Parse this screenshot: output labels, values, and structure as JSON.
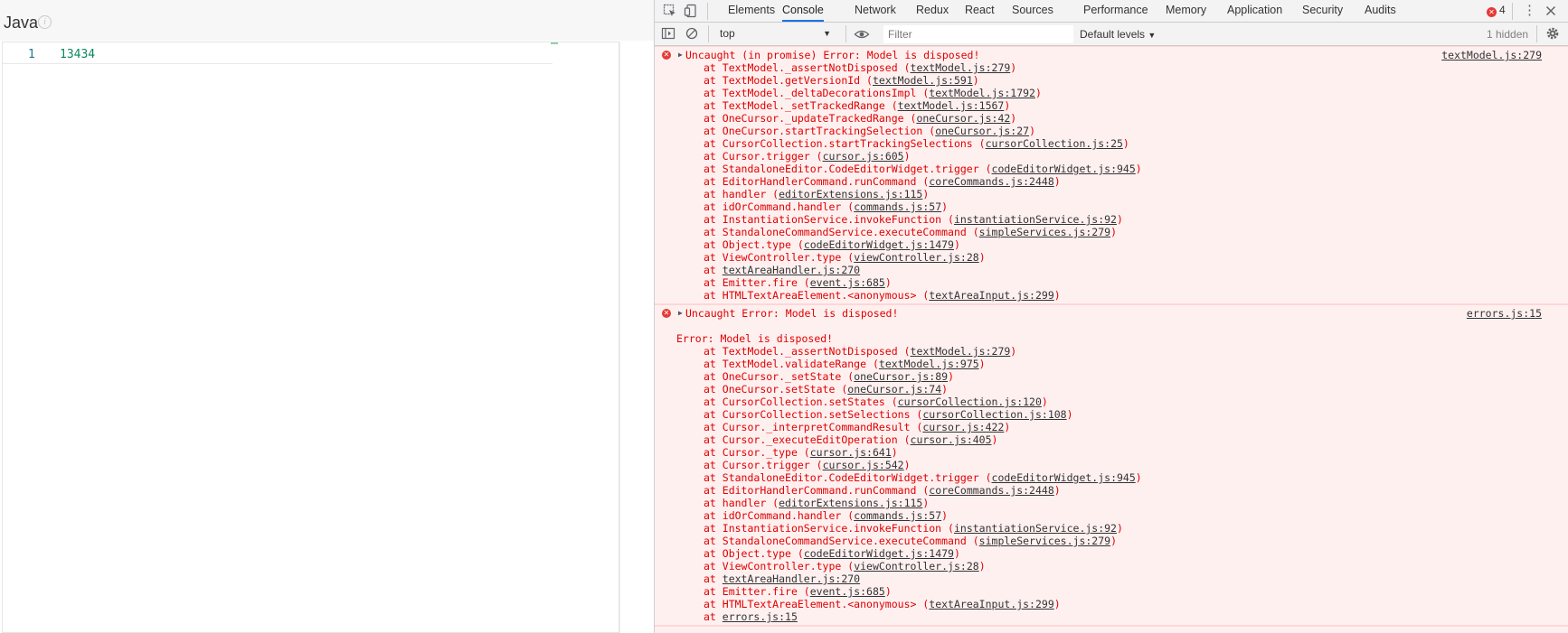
{
  "editor": {
    "language": "Java",
    "line_number": "1",
    "line_text": "13434"
  },
  "devtools": {
    "tabs": [
      "Elements",
      "Console",
      "Network",
      "Redux",
      "React",
      "Sources",
      "Performance",
      "Memory",
      "Application",
      "Security",
      "Audits"
    ],
    "active_tab": "Console",
    "error_count": "4",
    "context": "top",
    "filter_placeholder": "Filter",
    "levels": "Default levels",
    "hidden": "1 hidden"
  },
  "console": {
    "messages": [
      {
        "title": "Uncaught (in promise) Error: Model is disposed!",
        "source": "textModel.js:279",
        "frames": [
          {
            "fn": "TextModel._assertNotDisposed",
            "loc": "textModel.js:279"
          },
          {
            "fn": "TextModel.getVersionId",
            "loc": "textModel.js:591"
          },
          {
            "fn": "TextModel._deltaDecorationsImpl",
            "loc": "textModel.js:1792"
          },
          {
            "fn": "TextModel._setTrackedRange",
            "loc": "textModel.js:1567"
          },
          {
            "fn": "OneCursor._updateTrackedRange",
            "loc": "oneCursor.js:42"
          },
          {
            "fn": "OneCursor.startTrackingSelection",
            "loc": "oneCursor.js:27"
          },
          {
            "fn": "CursorCollection.startTrackingSelections",
            "loc": "cursorCollection.js:25"
          },
          {
            "fn": "Cursor.trigger",
            "loc": "cursor.js:605"
          },
          {
            "fn": "StandaloneEditor.CodeEditorWidget.trigger",
            "loc": "codeEditorWidget.js:945"
          },
          {
            "fn": "EditorHandlerCommand.runCommand",
            "loc": "coreCommands.js:2448"
          },
          {
            "fn": "handler",
            "loc": "editorExtensions.js:115"
          },
          {
            "fn": "idOrCommand.handler",
            "loc": "commands.js:57"
          },
          {
            "fn": "InstantiationService.invokeFunction",
            "loc": "instantiationService.js:92"
          },
          {
            "fn": "StandaloneCommandService.executeCommand",
            "loc": "simpleServices.js:279"
          },
          {
            "fn": "Object.type",
            "loc": "codeEditorWidget.js:1479"
          },
          {
            "fn": "ViewController.type",
            "loc": "viewController.js:28"
          },
          {
            "fn": "",
            "loc": "textAreaHandler.js:270"
          },
          {
            "fn": "Emitter.fire",
            "loc": "event.js:685"
          },
          {
            "fn": "HTMLTextAreaElement.<anonymous>",
            "loc": "textAreaInput.js:299"
          }
        ]
      },
      {
        "title": "Uncaught Error: Model is disposed!",
        "source": "errors.js:15",
        "subtitle": "Error: Model is disposed!",
        "frames": [
          {
            "fn": "TextModel._assertNotDisposed",
            "loc": "textModel.js:279"
          },
          {
            "fn": "TextModel.validateRange",
            "loc": "textModel.js:975"
          },
          {
            "fn": "OneCursor._setState",
            "loc": "oneCursor.js:89"
          },
          {
            "fn": "OneCursor.setState",
            "loc": "oneCursor.js:74"
          },
          {
            "fn": "CursorCollection.setStates",
            "loc": "cursorCollection.js:120"
          },
          {
            "fn": "CursorCollection.setSelections",
            "loc": "cursorCollection.js:108"
          },
          {
            "fn": "Cursor._interpretCommandResult",
            "loc": "cursor.js:422"
          },
          {
            "fn": "Cursor._executeEditOperation",
            "loc": "cursor.js:405"
          },
          {
            "fn": "Cursor._type",
            "loc": "cursor.js:641"
          },
          {
            "fn": "Cursor.trigger",
            "loc": "cursor.js:542"
          },
          {
            "fn": "StandaloneEditor.CodeEditorWidget.trigger",
            "loc": "codeEditorWidget.js:945"
          },
          {
            "fn": "EditorHandlerCommand.runCommand",
            "loc": "coreCommands.js:2448"
          },
          {
            "fn": "handler",
            "loc": "editorExtensions.js:115"
          },
          {
            "fn": "idOrCommand.handler",
            "loc": "commands.js:57"
          },
          {
            "fn": "InstantiationService.invokeFunction",
            "loc": "instantiationService.js:92"
          },
          {
            "fn": "StandaloneCommandService.executeCommand",
            "loc": "simpleServices.js:279"
          },
          {
            "fn": "Object.type",
            "loc": "codeEditorWidget.js:1479"
          },
          {
            "fn": "ViewController.type",
            "loc": "viewController.js:28"
          },
          {
            "fn": "",
            "loc": "textAreaHandler.js:270"
          },
          {
            "fn": "Emitter.fire",
            "loc": "event.js:685"
          },
          {
            "fn": "HTMLTextAreaElement.<anonymous>",
            "loc": "textAreaInput.js:299"
          },
          {
            "fn": "",
            "loc": "errors.js:15"
          }
        ]
      }
    ]
  }
}
